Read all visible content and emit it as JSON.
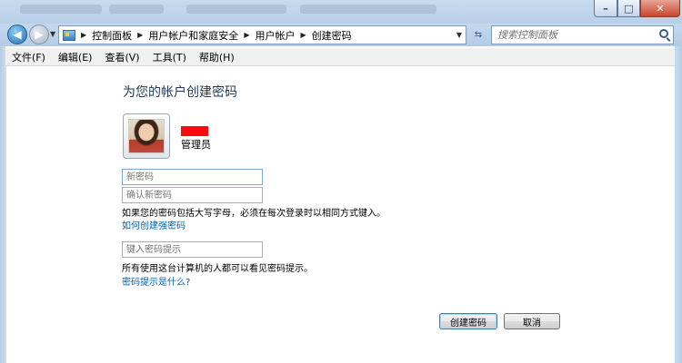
{
  "nav": {
    "breadcrumbs": [
      "控制面板",
      "用户帐户和家庭安全",
      "用户帐户",
      "创建密码"
    ],
    "search_placeholder": "搜索控制面板"
  },
  "menu": [
    "文件(F)",
    "编辑(E)",
    "查看(V)",
    "工具(T)",
    "帮助(H)"
  ],
  "main": {
    "heading": "为您的帐户创建密码",
    "account_role": "管理员",
    "new_password_placeholder": "新密码",
    "confirm_password_placeholder": "确认新密码",
    "caps_note": "如果您的密码包括大写字母，必须在每次登录时以相同方式键入。",
    "strong_password_link": "如何创建强密码",
    "hint_placeholder": "键入密码提示",
    "hint_note": "所有使用这台计算机的人都可以看见密码提示。",
    "hint_link": "密码提示是什么?",
    "create_button": "创建密码",
    "cancel_button": "取消"
  },
  "colors": {
    "heading": "#1e395b",
    "link": "#0b61a4",
    "redacted": "#ff0a0a"
  }
}
